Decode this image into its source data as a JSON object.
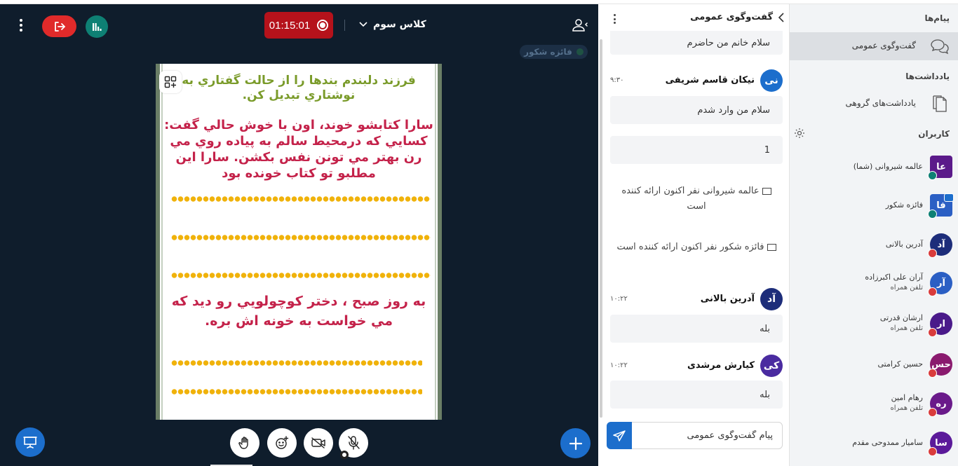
{
  "stage": {
    "timer": "01:15:01",
    "room_name": "کلاس سوم",
    "talker": "فائزه شکور"
  },
  "slide": {
    "line1": "فرزند دلبندم بندها را از حالت گفتاري به نوشتاري تبديل كن.",
    "line2": "سارا كتابشو خوند، اون با خوش حالي گفت: كسايي كه درمحيط سالم به پياده روي مي رن بهتر مي تونن نفس بكشن. سارا اين مطلبو تو كتاب خونده بود",
    "line3": "به روز صبح ، دختر كوچولويي رو ديد كه مي خواست به خونه اش بره."
  },
  "chat": {
    "title": "گفت‌وگوی عمومی",
    "messages": [
      {
        "type": "bubble",
        "text": "سلام خانم من حاضرم"
      },
      {
        "type": "head",
        "initials": "نی",
        "name": "نیکان قاسم شریفی",
        "time": "۹:۳۰",
        "color": "#1c6ecc"
      },
      {
        "type": "bubble",
        "text": "سلام من وارد شدم"
      },
      {
        "type": "bubble",
        "text": "1"
      },
      {
        "type": "system",
        "text": "عالمه شیروانی نفر اکنون ارائه کننده است"
      },
      {
        "type": "system",
        "text": "فائزه شکور نفر اکنون ارائه کننده است"
      },
      {
        "type": "head",
        "initials": "آد",
        "name": "آدرین بالانی",
        "time": "۱۰:۲۲",
        "color": "#1d2d7a"
      },
      {
        "type": "bubble",
        "text": "بله"
      },
      {
        "type": "head",
        "initials": "کی",
        "name": "کیارش مرشدی",
        "time": "۱۰:۲۲",
        "color": "#4a2ba0"
      },
      {
        "type": "bubble",
        "text": "بله"
      }
    ],
    "composer_placeholder": "پیام گفت‌وگوی عمومی"
  },
  "sidebar": {
    "messages_title": "پیام‌ها",
    "public_chat": "گفت‌وگوی عمومی",
    "notes_title": "یادداشت‌ها",
    "group_notes": "یادداشت‌های گروهی",
    "users_title": "کاربران",
    "users": [
      {
        "initials": "عا",
        "name": "عالمه شیروانی (شما)",
        "sub": "",
        "color": "#5b1a8a",
        "square": true,
        "badge": "teal",
        "presenter": false
      },
      {
        "initials": "فا",
        "name": "فائزه شکور",
        "sub": "",
        "color": "#2b5fc4",
        "square": true,
        "badge": "teal",
        "presenter": true
      },
      {
        "initials": "آد",
        "name": "آدرین بالانی",
        "sub": "",
        "color": "#1d2d7a",
        "square": false,
        "badge": "red",
        "presenter": false
      },
      {
        "initials": "آر",
        "name": "آران علی اکبرزاده",
        "sub": "تلفن همراه",
        "color": "#2b5fc4",
        "square": false,
        "badge": "red",
        "presenter": false
      },
      {
        "initials": "ار",
        "name": "ارشان قدرتی",
        "sub": "تلفن همراه",
        "color": "#4a1a8a",
        "square": false,
        "badge": "red",
        "presenter": false
      },
      {
        "initials": "حس",
        "name": "حسین کرامتی",
        "sub": "",
        "color": "#8a1a6e",
        "square": false,
        "badge": "red",
        "presenter": false
      },
      {
        "initials": "ره",
        "name": "رهام امین",
        "sub": "تلفن همراه",
        "color": "#6a1a8a",
        "square": false,
        "badge": "red",
        "presenter": false
      },
      {
        "initials": "سا",
        "name": "سامیار ممدوحی مقدم",
        "sub": "",
        "color": "#5b1a9a",
        "square": false,
        "badge": "red",
        "presenter": false
      }
    ]
  }
}
